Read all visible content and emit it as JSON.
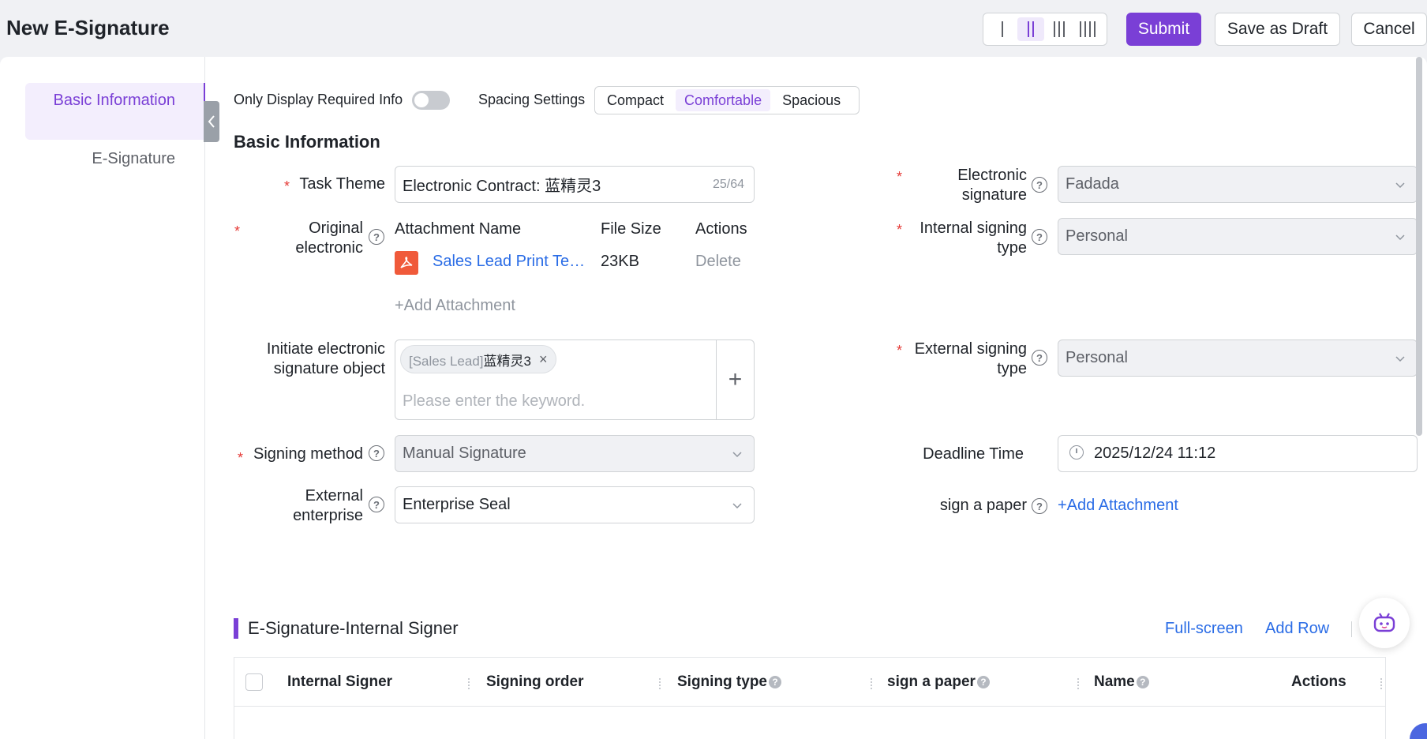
{
  "header": {
    "title": "New E-Signature",
    "submit_label": "Submit",
    "draft_label": "Save as Draft",
    "cancel_label": "Cancel"
  },
  "nav": {
    "items": [
      {
        "label": "Basic Information",
        "active": true
      },
      {
        "label": "E-Signature",
        "active": false
      }
    ]
  },
  "controls": {
    "required_only_label": "Only Display Required Info",
    "required_only_on": false,
    "spacing_label": "Spacing Settings",
    "spacing_options": [
      "Compact",
      "Comfortable",
      "Spacious"
    ],
    "spacing_selected": "Comfortable"
  },
  "basic": {
    "section_title": "Basic Information",
    "task_theme": {
      "label": "Task Theme",
      "value": "Electronic Contract: 蓝精灵3",
      "count": "25/64"
    },
    "original": {
      "label": "Original electronic",
      "col_name": "Attachment Name",
      "col_size": "File Size",
      "col_actions": "Actions",
      "file_name": "Sales Lead Print Te…",
      "file_size": "23KB",
      "delete_label": "Delete",
      "add_label": "+Add Attachment"
    },
    "initiate": {
      "label": "Initiate electronic signature object",
      "tag_prefix": "[Sales Lead]",
      "tag_name": "蓝精灵3",
      "placeholder": "Please enter the keyword."
    },
    "signing_method": {
      "label": "Signing method",
      "value": "Manual Signature"
    },
    "external_enterprise": {
      "label": "External enterprise",
      "value": "Enterprise Seal"
    },
    "electronic_signature": {
      "label": "Electronic signature",
      "value": "Fadada"
    },
    "internal_signing_type": {
      "label": "Internal signing type",
      "value": "Personal"
    },
    "external_signing_type": {
      "label": "External signing type",
      "value": "Personal"
    },
    "deadline": {
      "label": "Deadline Time",
      "value": "2025/12/24 11:12"
    },
    "sign_paper": {
      "label": "sign a paper",
      "add_label": "+Add Attachment"
    }
  },
  "signers": {
    "title": "E-Signature-Internal Signer",
    "fullscreen_label": "Full-screen",
    "add_row_label": "Add Row",
    "columns": [
      "Internal Signer",
      "Signing order",
      "Signing type",
      "sign a paper",
      "Name",
      "Actions"
    ]
  },
  "colors": {
    "accent": "#7a3fd6",
    "link": "#2a6ce6",
    "required": "#e53935",
    "pdf": "#f05a3a"
  }
}
